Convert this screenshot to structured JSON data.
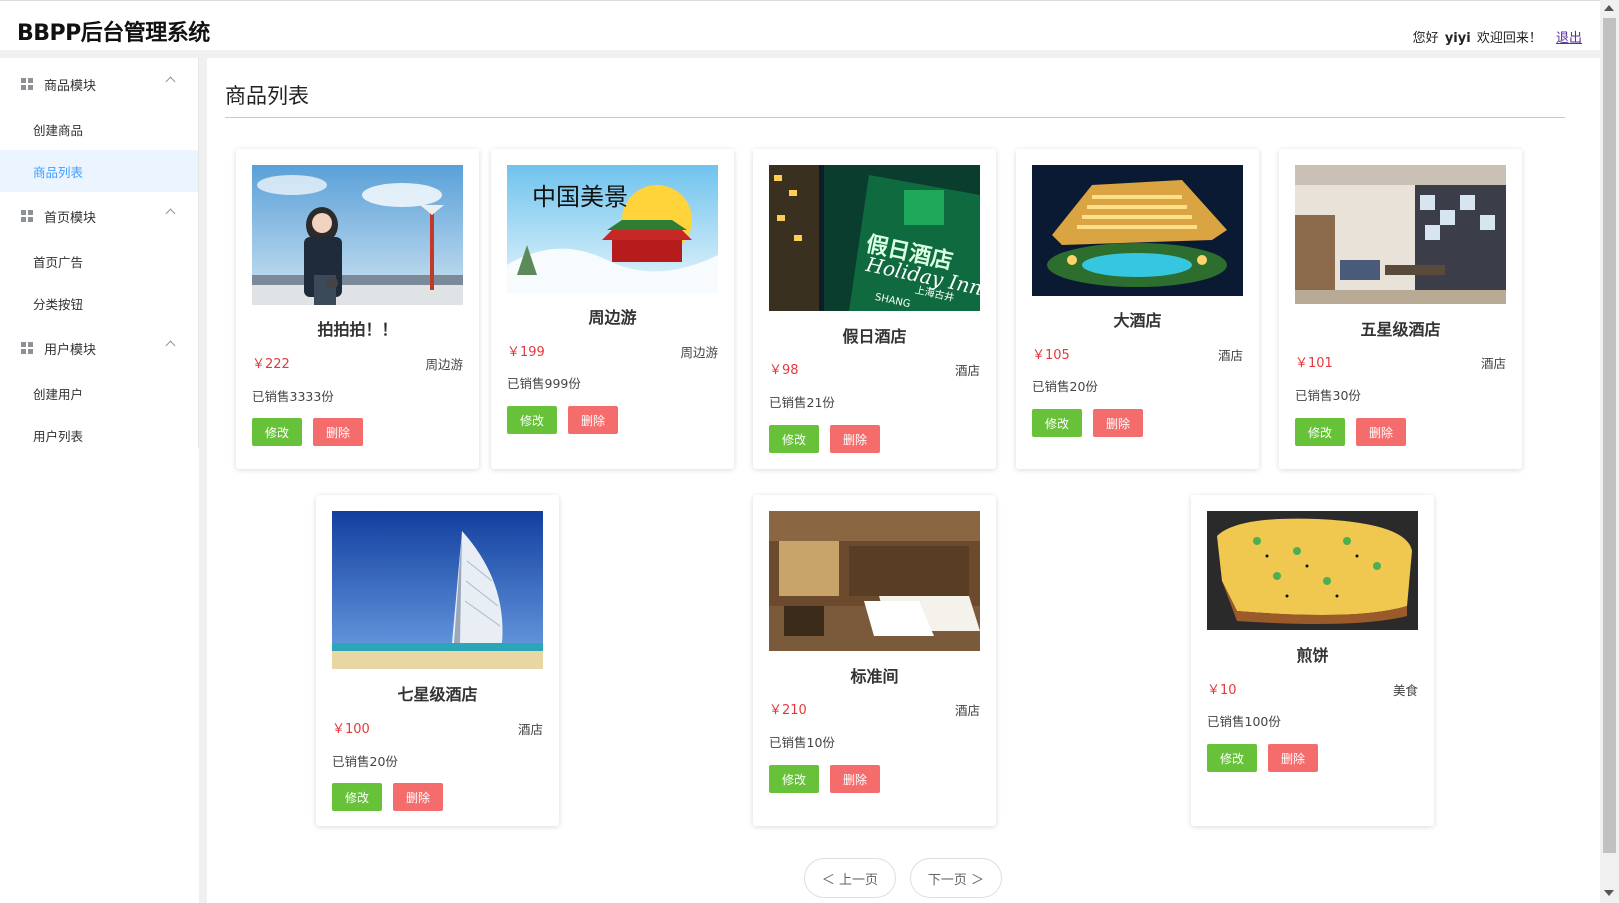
{
  "header": {
    "title": "BBPP后台管理系统",
    "greeting": "您好",
    "username": "yiyi",
    "welcome": "欢迎回来！",
    "logout": "退出"
  },
  "sidebar": {
    "groups": [
      {
        "label": "商品模块",
        "items": [
          {
            "label": "创建商品"
          },
          {
            "label": "商品列表",
            "active": true
          }
        ]
      },
      {
        "label": "首页模块",
        "items": [
          {
            "label": "首页广告"
          },
          {
            "label": "分类按钮"
          }
        ]
      },
      {
        "label": "用户模块",
        "items": [
          {
            "label": "创建用户"
          },
          {
            "label": "用户列表"
          }
        ]
      }
    ]
  },
  "main": {
    "title": "商品列表"
  },
  "products": [
    {
      "name": "拍拍拍！！",
      "price": "￥222",
      "category": "周边游",
      "sold": "已销售3333份",
      "edit": "修改",
      "delete": "删除",
      "image": "girl-at-seaside-photo"
    },
    {
      "name": "周边游",
      "price": "￥199",
      "category": "周边游",
      "sold": "已销售999份",
      "edit": "修改",
      "delete": "删除",
      "image": "china-travel-illustration",
      "image_text": "中国美景"
    },
    {
      "name": "假日酒店",
      "price": "￥98",
      "category": "酒店",
      "sold": "已销售21份",
      "edit": "修改",
      "delete": "删除",
      "image": "holiday-inn-sign-photo",
      "image_text": [
        "假日酒店",
        "Holiday Inn",
        "上海古井",
        "SHANG"
      ]
    },
    {
      "name": "大酒店",
      "price": "￥105",
      "category": "酒店",
      "sold": "已销售20份",
      "edit": "修改",
      "delete": "删除",
      "image": "resort-hotel-night-photo"
    },
    {
      "name": "五星级酒店",
      "price": "￥101",
      "category": "酒店",
      "sold": "已销售30份",
      "edit": "修改",
      "delete": "删除",
      "image": "hotel-lobby-photo"
    },
    {
      "name": "七星级酒店",
      "price": "￥100",
      "category": "酒店",
      "sold": "已销售20份",
      "edit": "修改",
      "delete": "删除",
      "image": "burj-al-arab-photo"
    },
    {
      "name": "标准间",
      "price": "￥210",
      "category": "酒店",
      "sold": "已销售10份",
      "edit": "修改",
      "delete": "删除",
      "image": "twin-bed-room-photo"
    },
    {
      "name": "煎饼",
      "price": "￥10",
      "category": "美食",
      "sold": "已销售100份",
      "edit": "修改",
      "delete": "删除",
      "image": "jianbing-food-photo"
    }
  ],
  "pagination": {
    "prev": "＜ 上一页",
    "next": "下一页 ＞"
  },
  "colors": {
    "accent": "#409eff",
    "edit": "#67c23a",
    "delete": "#f56c6c",
    "price": "#e4393c"
  }
}
